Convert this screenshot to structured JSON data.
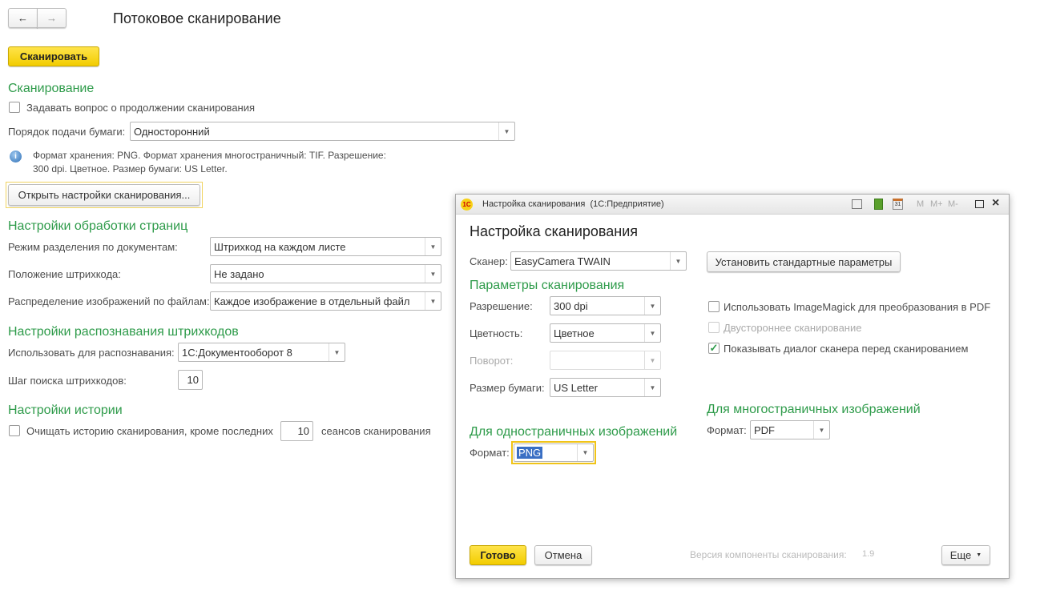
{
  "page": {
    "title": "Потоковое сканирование",
    "back": "←",
    "forward": "→",
    "scan_button": "Сканировать",
    "scanning": {
      "heading": "Сканирование",
      "ask_continue": "Задавать вопрос о продолжении сканирования",
      "ask_continue_checked": false,
      "paper_order_label": "Порядок подачи бумаги:",
      "paper_order_value": "Односторонний",
      "info_line1": "Формат хранения: PNG. Формат хранения многостраничный: TIF. Разрешение:",
      "info_line2": "300 dpi. Цветное. Размер бумаги: US Letter.",
      "open_settings": "Открыть настройки сканирования..."
    },
    "pages": {
      "heading": "Настройки обработки страниц",
      "split_label": "Режим разделения по документам:",
      "split_value": "Штрихкод на каждом листе",
      "barcode_pos_label": "Положение штрихкода:",
      "barcode_pos_value": "Не задано",
      "distrib_label": "Распределение изображений по файлам:",
      "distrib_value": "Каждое изображение в отдельный файл"
    },
    "barcodes": {
      "heading": "Настройки распознавания штрихкодов",
      "use_label": "Использовать для распознавания:",
      "use_value": "1С:Документооборот 8",
      "step_label": "Шаг поиска штрихкодов:",
      "step_value": "10"
    },
    "history": {
      "heading": "Настройки истории",
      "clear_label": "Очищать историю сканирования, кроме последних",
      "clear_checked": false,
      "count": "10",
      "suffix": "сеансов сканирования"
    }
  },
  "dialog": {
    "window_title": "Настройка сканирования  (1С:Предприятие)",
    "logo": "1С",
    "toolbar": [
      "M",
      "M+",
      "M-"
    ],
    "calendar": "31",
    "heading": "Настройка сканирования",
    "scanner_label": "Сканер:",
    "scanner_value": "EasyCamera TWAIN",
    "defaults_button": "Установить стандартные параметры",
    "params_heading": "Параметры сканирования",
    "resolution_label": "Разрешение:",
    "resolution_value": "300 dpi",
    "color_label": "Цветность:",
    "color_value": "Цветное",
    "rotation_label": "Поворот:",
    "rotation_value": "",
    "paper_label": "Размер бумаги:",
    "paper_value": "US Letter",
    "imagemagick": "Использовать ImageMagick для преобразования в PDF",
    "imagemagick_checked": false,
    "duplex": "Двустороннее сканирование",
    "duplex_checked": false,
    "show_dialog": "Показывать диалог сканера перед сканированием",
    "show_dialog_checked": true,
    "single_heading": "Для одностраничных изображений",
    "single_format_label": "Формат:",
    "single_format_value": "PNG",
    "multi_heading": "Для многостраничных изображений",
    "multi_format_label": "Формат:",
    "multi_format_value": "PDF",
    "ok": "Готово",
    "cancel": "Отмена",
    "version": "Версия компоненты сканирования:",
    "version_value": "1.9",
    "more": "Еще"
  }
}
